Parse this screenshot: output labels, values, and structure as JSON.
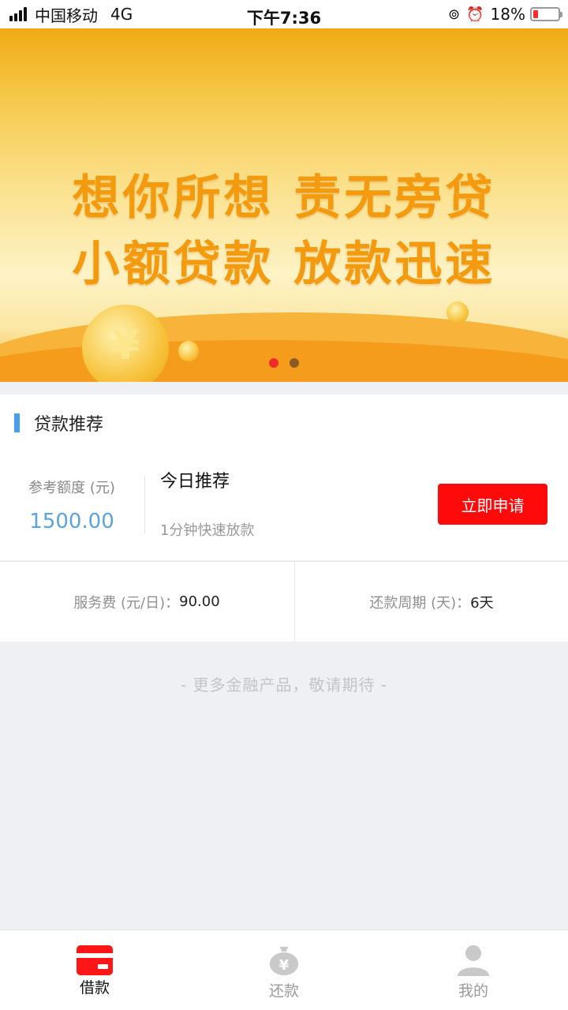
{
  "status_bar": {
    "carrier": "中国移动",
    "network": "4G",
    "time": "下午7:36",
    "battery": "18%"
  },
  "banner": {
    "line1": "想你所想 责无旁贷",
    "line2": "小额贷款 放款迅速",
    "coin_symbol": "¥",
    "slide_count": 2,
    "active_slide": 1
  },
  "section": {
    "title": "贷款推荐",
    "accent_color": "#4a9ef0"
  },
  "loan": {
    "amount_label": "参考额度 (元)",
    "amount_value": "1500.00",
    "product_title": "今日推荐",
    "product_subtitle": "1分钟快速放款",
    "apply_label": "立即申请",
    "apply_color": "#ff0a0a",
    "fee_label": "服务费 (元/日)：",
    "fee_value": "90.00",
    "period_label": "还款周期 (天)：",
    "period_value": "6天"
  },
  "footer_note": "- 更多金融产品，敬请期待 -",
  "tabs": [
    {
      "label": "借款",
      "icon": "card-icon",
      "active": true
    },
    {
      "label": "还款",
      "icon": "money-bag-icon",
      "active": false
    },
    {
      "label": "我的",
      "icon": "user-icon",
      "active": false
    }
  ]
}
